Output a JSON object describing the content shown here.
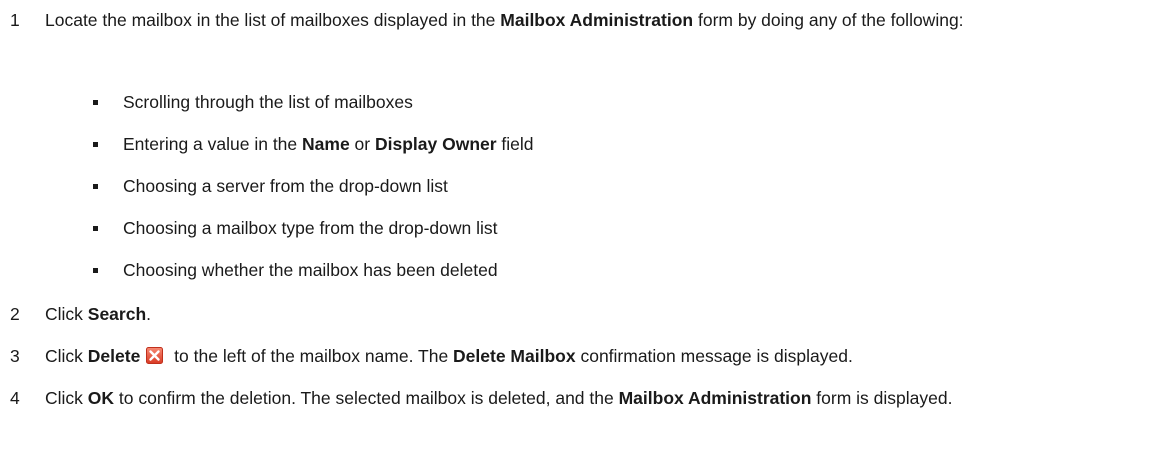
{
  "steps": [
    {
      "num": "1",
      "parts": {
        "a": "Locate the mailbox in the list of mailboxes displayed in the ",
        "b": "Mailbox Administration",
        "c": " form by doing any of the following:"
      },
      "bullets": [
        "Scrolling through the list of mailboxes",
        {
          "a": "Entering a value in the ",
          "b": "Name",
          "c": " or ",
          "d": "Display Owner",
          "e": " field"
        },
        "Choosing a server from the drop-down list",
        "Choosing a mailbox type from the drop-down list",
        "Choosing whether the mailbox has been deleted"
      ]
    },
    {
      "num": "2",
      "parts": {
        "a": "Click ",
        "b": "Search",
        "c": "."
      }
    },
    {
      "num": "3",
      "parts": {
        "a": "Click ",
        "b": "Delete",
        "icon": "delete-x-icon",
        "c": " to the left of the mailbox name. The ",
        "d": "Delete Mailbox",
        "e": " confirmation message is displayed."
      }
    },
    {
      "num": "4",
      "parts": {
        "a": "Click ",
        "b": "OK",
        "c": " to confirm the deletion. The selected mailbox is deleted, and the ",
        "d": "Mailbox Administration",
        "e": " form is displayed."
      }
    }
  ],
  "colors": {
    "text": "#1a1a1a",
    "delete_icon_red": "#e8503a"
  }
}
